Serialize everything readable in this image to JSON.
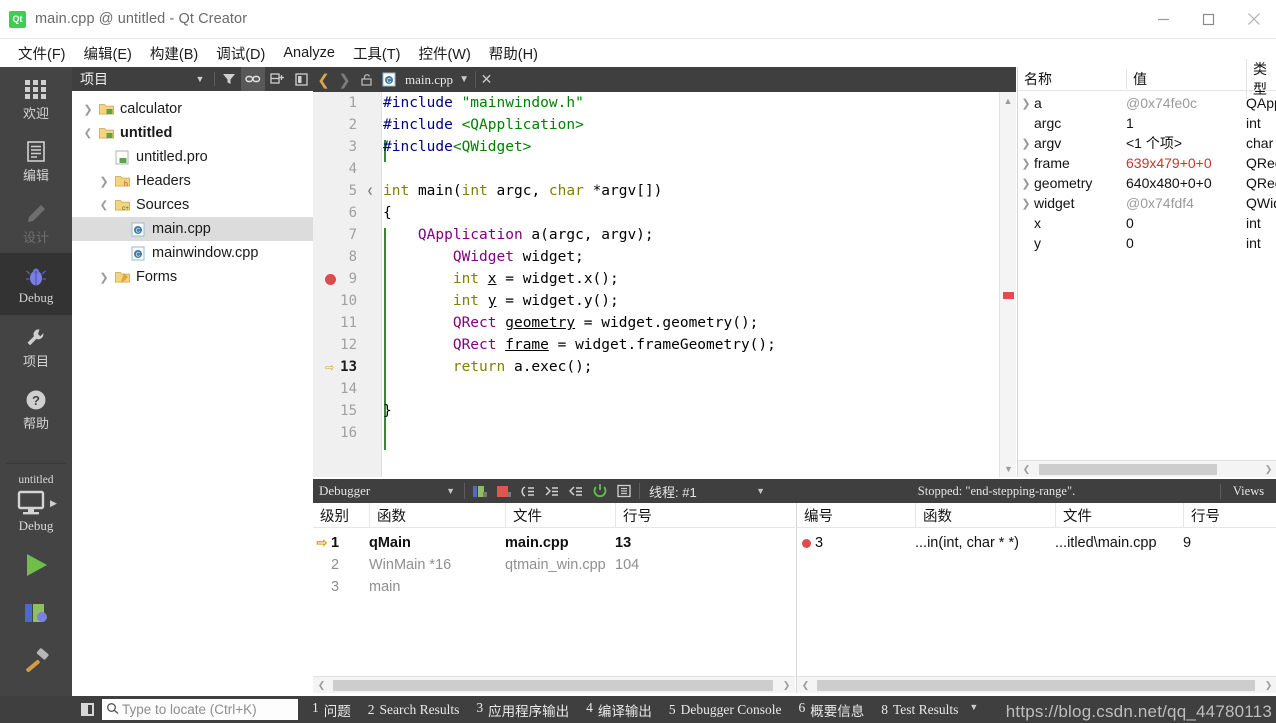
{
  "window": {
    "title": "main.cpp @ untitled - Qt Creator",
    "app_icon": "Qt",
    "minimize": "minimize-icon",
    "maximize": "maximize-icon",
    "close": "close-icon"
  },
  "menubar": {
    "items": [
      {
        "label": "文件(F)"
      },
      {
        "label": "编辑(E)"
      },
      {
        "label": "构建(B)"
      },
      {
        "label": "调试(D)"
      },
      {
        "label": "Analyze"
      },
      {
        "label": "工具(T)"
      },
      {
        "label": "控件(W)"
      },
      {
        "label": "帮助(H)"
      }
    ]
  },
  "modebar": {
    "modes": [
      {
        "label": "欢迎",
        "icon": "grid-icon",
        "state": "normal"
      },
      {
        "label": "编辑",
        "icon": "document-icon",
        "state": "normal"
      },
      {
        "label": "设计",
        "icon": "pencil-icon",
        "state": "disabled"
      },
      {
        "label": "Debug",
        "icon": "bug-icon",
        "state": "active"
      },
      {
        "label": "项目",
        "icon": "wrench-icon",
        "state": "normal"
      },
      {
        "label": "帮助",
        "icon": "question-icon",
        "state": "normal"
      }
    ],
    "kit": {
      "project": "untitled",
      "config": "Debug",
      "monitor_icon": "monitor-icon",
      "expand_icon": "chevron-right-icon"
    },
    "actions": [
      {
        "name": "run-button",
        "icon": "play-icon"
      },
      {
        "name": "debug-button",
        "icon": "debug-start-icon"
      },
      {
        "name": "build-button",
        "icon": "hammer-icon"
      }
    ]
  },
  "project_panel": {
    "title": "项目",
    "tools": [
      {
        "name": "dropdown-caret-icon"
      },
      {
        "name": "filter-icon"
      },
      {
        "name": "link-sync-icon",
        "active": true
      },
      {
        "name": "collapse-all-icon"
      },
      {
        "name": "dock-icon"
      }
    ],
    "tree": [
      {
        "label": "calculator",
        "depth": 0,
        "arrow": "collapsed",
        "icon": "project-icon",
        "bold": false,
        "selected": false
      },
      {
        "label": "untitled",
        "depth": 0,
        "arrow": "expanded",
        "icon": "project-icon",
        "bold": true,
        "selected": false
      },
      {
        "label": "untitled.pro",
        "depth": 1,
        "arrow": "none",
        "icon": "pro-file-icon",
        "bold": false,
        "selected": false
      },
      {
        "label": "Headers",
        "depth": 1,
        "arrow": "collapsed",
        "icon": "headers-folder-icon",
        "bold": false,
        "selected": false
      },
      {
        "label": "Sources",
        "depth": 1,
        "arrow": "expanded",
        "icon": "sources-folder-icon",
        "bold": false,
        "selected": false
      },
      {
        "label": "main.cpp",
        "depth": 2,
        "arrow": "none",
        "icon": "cpp-file-icon",
        "bold": false,
        "selected": true
      },
      {
        "label": "mainwindow.cpp",
        "depth": 2,
        "arrow": "none",
        "icon": "cpp-file-icon",
        "bold": false,
        "selected": false
      },
      {
        "label": "Forms",
        "depth": 1,
        "arrow": "collapsed",
        "icon": "forms-folder-icon",
        "bold": false,
        "selected": false
      }
    ]
  },
  "editor": {
    "back_icon": "chevron-left-icon",
    "forward_icon": "chevron-right-icon",
    "lock_icon": "unlocked-icon",
    "file_icon": "cpp-file-icon",
    "filename": "main.cpp",
    "dropdown_icon": "chevron-down-icon",
    "close_icon": "close-icon",
    "breadcrumb": "#",
    "more_icon": "»",
    "split_icon": "split-editor-icon",
    "current_line": 13,
    "breakpoint_line": 9,
    "lines": [
      {
        "n": 1,
        "text": "#include \"mainwindow.h\""
      },
      {
        "n": 2,
        "text": "#include <QApplication>"
      },
      {
        "n": 3,
        "text": "#include<QWidget>"
      },
      {
        "n": 4,
        "text": ""
      },
      {
        "n": 5,
        "text": "int main(int argc, char *argv[])"
      },
      {
        "n": 6,
        "text": "{"
      },
      {
        "n": 7,
        "text": "    QApplication a(argc, argv);"
      },
      {
        "n": 8,
        "text": "        QWidget widget;"
      },
      {
        "n": 9,
        "text": "        int x = widget.x();"
      },
      {
        "n": 10,
        "text": "        int y = widget.y();"
      },
      {
        "n": 11,
        "text": "        QRect geometry = widget.geometry();"
      },
      {
        "n": 12,
        "text": "        QRect frame = widget.frameGeometry();"
      },
      {
        "n": 13,
        "text": "        return a.exec();"
      },
      {
        "n": 14,
        "text": ""
      },
      {
        "n": 15,
        "text": "}"
      },
      {
        "n": 16,
        "text": ""
      }
    ]
  },
  "variables_panel": {
    "columns": [
      "名称",
      "值",
      "类型"
    ],
    "rows": [
      {
        "name": "a",
        "value": "@0x74fe0c",
        "type": "QApp",
        "expandable": true,
        "value_color": "grey"
      },
      {
        "name": "argc",
        "value": "1",
        "type": "int",
        "expandable": false,
        "value_color": "black"
      },
      {
        "name": "argv",
        "value": "<1 个项>",
        "type": "char ",
        "expandable": true,
        "value_color": "black"
      },
      {
        "name": "frame",
        "value": "639x479+0+0",
        "type": "QRec",
        "expandable": true,
        "value_color": "red"
      },
      {
        "name": "geometry",
        "value": "640x480+0+0",
        "type": "QRec",
        "expandable": true,
        "value_color": "black"
      },
      {
        "name": "widget",
        "value": "@0x74fdf4",
        "type": "QWid",
        "expandable": true,
        "value_color": "grey"
      },
      {
        "name": "x",
        "value": "0",
        "type": "int",
        "expandable": false,
        "value_color": "black"
      },
      {
        "name": "y",
        "value": "0",
        "type": "int",
        "expandable": false,
        "value_color": "black"
      }
    ]
  },
  "debugger_bar": {
    "combo_label": "Debugger",
    "combo_caret_icon": "chevron-down-icon",
    "buttons": [
      {
        "name": "continue-icon"
      },
      {
        "name": "stop-icon"
      },
      {
        "name": "step-over-icon"
      },
      {
        "name": "step-into-icon"
      },
      {
        "name": "step-out-icon"
      },
      {
        "name": "restart-icon"
      },
      {
        "name": "instruction-step-icon"
      }
    ],
    "thread_label": "线程: #1",
    "thread_caret_icon": "chevron-down-icon",
    "status": "Stopped: \"end-stepping-range\".",
    "views_label": "Views"
  },
  "stack_pane": {
    "columns": [
      "级别",
      "函数",
      "文件",
      "行号"
    ],
    "rows": [
      {
        "level": "1",
        "function": "qMain",
        "file": "main.cpp",
        "line": "13",
        "current": true
      },
      {
        "level": "2",
        "function": "WinMain *16",
        "file": "qtmain_win.cpp",
        "line": "104",
        "current": false
      },
      {
        "level": "3",
        "function": "main",
        "file": "",
        "line": "",
        "current": false
      }
    ]
  },
  "breakpoints_pane": {
    "columns": [
      "编号",
      "函数",
      "文件",
      "行号"
    ],
    "rows": [
      {
        "number": "3",
        "function": "...in(int, char * *)",
        "file": "...itled\\main.cpp",
        "line": "9"
      }
    ]
  },
  "statusbar": {
    "toggle_sidebar_icon": "toggle-sidebar-icon",
    "search_icon": "search-icon",
    "search_placeholder": "Type to locate (Ctrl+K)",
    "items": [
      {
        "num": "1",
        "label": "问题"
      },
      {
        "num": "2",
        "label": "Search Results"
      },
      {
        "num": "3",
        "label": "应用程序输出"
      },
      {
        "num": "4",
        "label": "编译输出"
      },
      {
        "num": "5",
        "label": "Debugger Console"
      },
      {
        "num": "6",
        "label": "概要信息"
      },
      {
        "num": "8",
        "label": "Test Results"
      }
    ],
    "caret_icon": "chevron-down-icon",
    "watermark": "https://blog.csdn.net/qq_44780113"
  },
  "colors": {
    "chrome_dark": "#3f3f3f",
    "modebar": "#444444",
    "accent_green": "#41cd52",
    "breakpoint_red": "#e04a4a",
    "current_arrow": "#d3a017"
  }
}
